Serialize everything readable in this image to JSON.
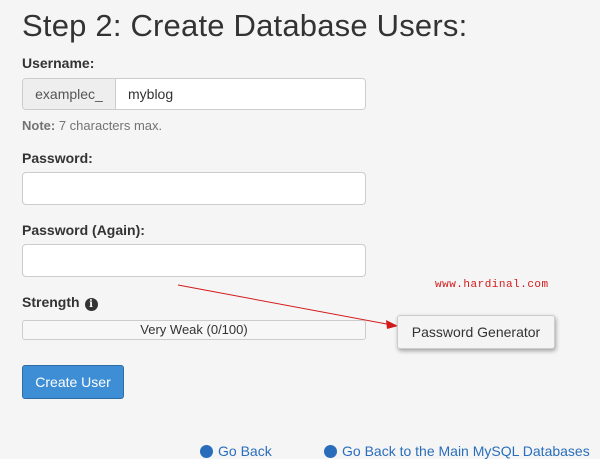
{
  "page": {
    "title": "Step 2: Create Database Users:"
  },
  "form": {
    "username_label": "Username:",
    "username_prefix": "examplec_",
    "username_value": "myblog",
    "note_label": "Note:",
    "note_text": " 7 characters max.",
    "password_label": "Password:",
    "password_again_label": "Password (Again):",
    "strength_label": "Strength",
    "strength_text": "Very Weak (0/100)",
    "strength_percent": 0,
    "password_generator_label": "Password Generator",
    "create_user_label": "Create User"
  },
  "watermark": "www.hardinal.com",
  "footer_links": [
    {
      "label": "Go Back"
    },
    {
      "label": "Go Back to the Main MySQL Databases"
    }
  ],
  "colors": {
    "primary_button": "#3d8ed4",
    "annotation": "#d21a1a"
  }
}
